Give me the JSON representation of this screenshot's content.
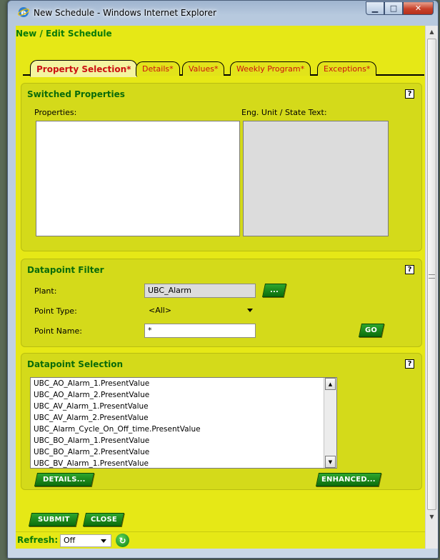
{
  "window": {
    "title": "New Schedule - Windows Internet Explorer"
  },
  "page": {
    "header": "New / Edit Schedule"
  },
  "tabs": [
    {
      "label": "Property Selection*"
    },
    {
      "label": "Details*"
    },
    {
      "label": "Values*"
    },
    {
      "label": "Weekly Program*"
    },
    {
      "label": "Exceptions*"
    }
  ],
  "switched_properties": {
    "title": "Switched Properties",
    "properties_label": "Properties:",
    "eng_unit_label": "Eng. Unit / State Text:",
    "help": "?"
  },
  "datapoint_filter": {
    "title": "Datapoint Filter",
    "help": "?",
    "plant_label": "Plant:",
    "plant_value": "UBC_Alarm",
    "browse_label": "...",
    "point_type_label": "Point Type:",
    "point_type_value": "<All>",
    "point_name_label": "Point Name:",
    "point_name_value": "*",
    "go_label": "GO"
  },
  "datapoint_selection": {
    "title": "Datapoint Selection",
    "help": "?",
    "items": [
      "UBC_AO_Alarm_1.PresentValue",
      "UBC_AO_Alarm_2.PresentValue",
      "UBC_AV_Alarm_1.PresentValue",
      "UBC_AV_Alarm_2.PresentValue",
      "UBC_Alarm_Cycle_On_Off_time.PresentValue",
      "UBC_BO_Alarm_1.PresentValue",
      "UBC_BO_Alarm_2.PresentValue",
      "UBC_BV_Alarm_1.PresentValue"
    ],
    "details_label": "DETAILS...",
    "enhanced_label": "ENHANCED..."
  },
  "actions": {
    "submit_label": "SUBMIT",
    "close_label": "CLOSE"
  },
  "refresh": {
    "label": "Refresh:",
    "value": "Off"
  },
  "colors": {
    "background": "#e6e816",
    "panel": "#d4da1a",
    "accent_green": "#0a7a0a",
    "tab_text": "#cc1111"
  },
  "icons": {
    "browser": "ie-icon",
    "refresh": "refresh-icon",
    "help": "help-icon"
  }
}
